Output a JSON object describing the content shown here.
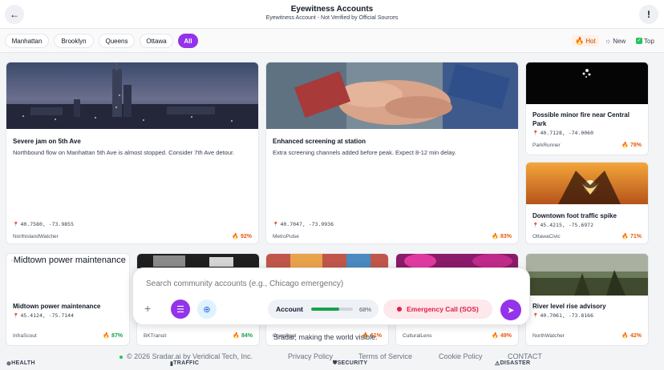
{
  "header": {
    "title": "Eyewitness Accounts",
    "subtitle": "Eyewitness Account - Not Verified by Official Sources",
    "back_icon": "←",
    "info_icon": "!"
  },
  "filters": {
    "locations": [
      "Manhattan",
      "Brooklyn",
      "Queens",
      "Ottawa",
      "All"
    ],
    "selected": "All",
    "sort": {
      "hot": "Hot",
      "new": "New",
      "top": "Top",
      "selected": "Hot"
    }
  },
  "cards": [
    {
      "title": "Severe jam on 5th Ave",
      "desc": "Northbound flow on Manhattan 5th Ave is almost stopped. Consider 7th Ave detour.",
      "coords": "40.7580, -73.9855",
      "author": "NorthislandWatcher",
      "score": "92%"
    },
    {
      "title": "Enhanced screening at station",
      "desc": "Extra screening channels added before peak. Expect 8-12 min delay.",
      "coords": "40.7047, -73.9936",
      "author": "MetroPulse",
      "score": "83%"
    },
    {
      "title": "Possible minor fire near Central Park",
      "coords": "40.7128, -74.0060",
      "author": "ParkRunner",
      "score": "78%"
    },
    {
      "title": "Downtown foot traffic spike",
      "coords": "45.4215, -75.6972",
      "author": "OttawaCivic",
      "score": "71%"
    },
    {
      "alt": "Midtown power maintenance",
      "title": "Midtown power maintenance",
      "coords": "45.4124, -75.7144",
      "author": "InfraScout",
      "score": "87%"
    },
    {
      "author": "BKTransit",
      "score": "84%"
    },
    {
      "author": "OpenSpot",
      "score": "61%"
    },
    {
      "author": "CulturalLens",
      "score": "49%"
    },
    {
      "title": "River level rise advisory",
      "coords": "40.7061, -73.8166",
      "author": "NorthWatcher",
      "score": "42%"
    }
  ],
  "composer": {
    "search_placeholder": "Search community accounts (e.g., Chicago emergency)",
    "plus_icon": "+",
    "list_icon": "☰",
    "globe_icon": "⊕",
    "account_label": "Account",
    "account_progress": 68,
    "account_pct": "68%",
    "sos_label": "Emergency Call (SOS)",
    "send_icon": "➤"
  },
  "tagline": "Sradar, making the world visible.",
  "footer": {
    "copyright": "© 2026 Sradar.ai by Veridical Tech, Inc.",
    "privacy": "Privacy Policy",
    "terms": "Terms of Service",
    "cookie": "Cookie Policy",
    "contact": "CONTACT"
  },
  "categories": [
    "HEALTH",
    "TRAFFIC",
    "SECURITY",
    "DISASTER"
  ],
  "colors": {
    "accent": "#9333ea",
    "hot": "#f97316",
    "sos": "#e11d48",
    "progress": "#16a34a"
  }
}
